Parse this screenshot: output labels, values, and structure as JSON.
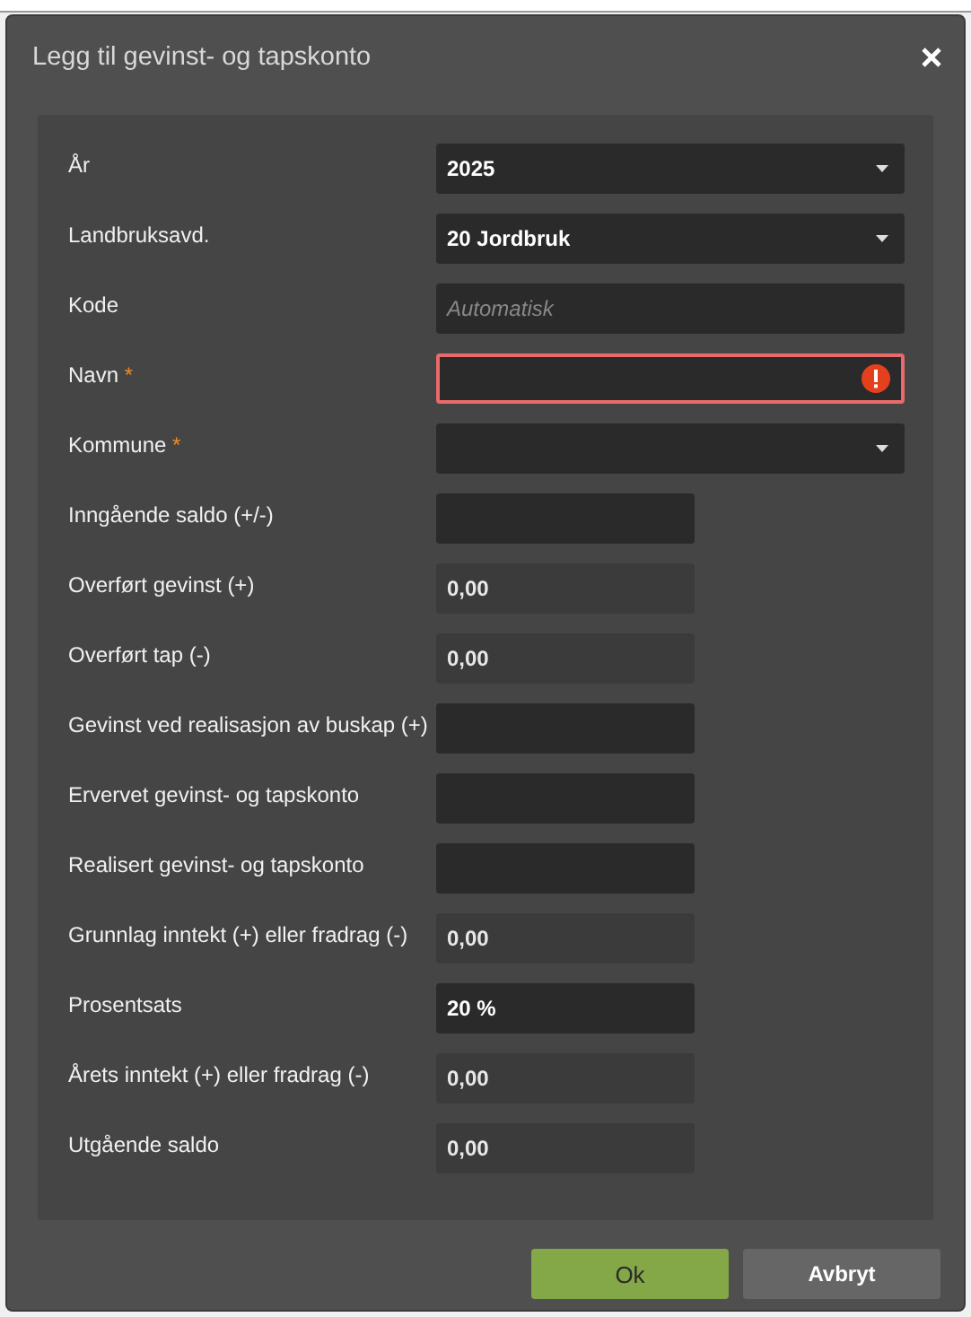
{
  "dialog": {
    "title": "Legg til gevinst- og tapskonto"
  },
  "fields": [
    {
      "kind": "select",
      "label": "År",
      "value": "2025",
      "invalid": false,
      "disabled": false
    },
    {
      "kind": "select",
      "label": "Landbruksavd.",
      "value": "20 Jordbruk",
      "invalid": false,
      "disabled": false
    },
    {
      "kind": "text",
      "label": "Kode",
      "placeholder": "Automatisk",
      "invalid": false,
      "disabled": false
    },
    {
      "kind": "text",
      "label": "Navn",
      "required_mark": "*",
      "invalid": true,
      "disabled": false
    },
    {
      "kind": "select",
      "label": "Kommune",
      "required_mark": "*",
      "invalid": false,
      "disabled": false
    },
    {
      "kind": "number",
      "label": "Inngående saldo (+/-)",
      "invalid": false,
      "disabled": false
    },
    {
      "kind": "number",
      "label": "Overført gevinst (+)",
      "value": "0,00",
      "invalid": false,
      "disabled": true
    },
    {
      "kind": "number",
      "label": "Overført tap (-)",
      "value": "0,00",
      "invalid": false,
      "disabled": true
    },
    {
      "kind": "number",
      "label": "Gevinst ved realisasjon av buskap (+)",
      "invalid": false,
      "disabled": false
    },
    {
      "kind": "number",
      "label": "Ervervet gevinst- og tapskonto",
      "invalid": false,
      "disabled": false
    },
    {
      "kind": "number",
      "label": "Realisert gevinst- og tapskonto",
      "invalid": false,
      "disabled": false
    },
    {
      "kind": "number",
      "label": "Grunnlag inntekt (+) eller fradrag (-)",
      "value": "0,00",
      "invalid": false,
      "disabled": true
    },
    {
      "kind": "number",
      "label": "Prosentsats",
      "value": "20 %",
      "invalid": false,
      "disabled": false
    },
    {
      "kind": "number",
      "label": "Årets inntekt (+) eller fradrag (-)",
      "value": "0,00",
      "invalid": false,
      "disabled": true
    },
    {
      "kind": "number",
      "label": "Utgående saldo",
      "value": "0,00",
      "invalid": false,
      "disabled": true
    }
  ],
  "buttons": [
    {
      "kind": "primary",
      "label": "Ok"
    },
    {
      "kind": "secondary",
      "label": "Avbryt"
    }
  ]
}
